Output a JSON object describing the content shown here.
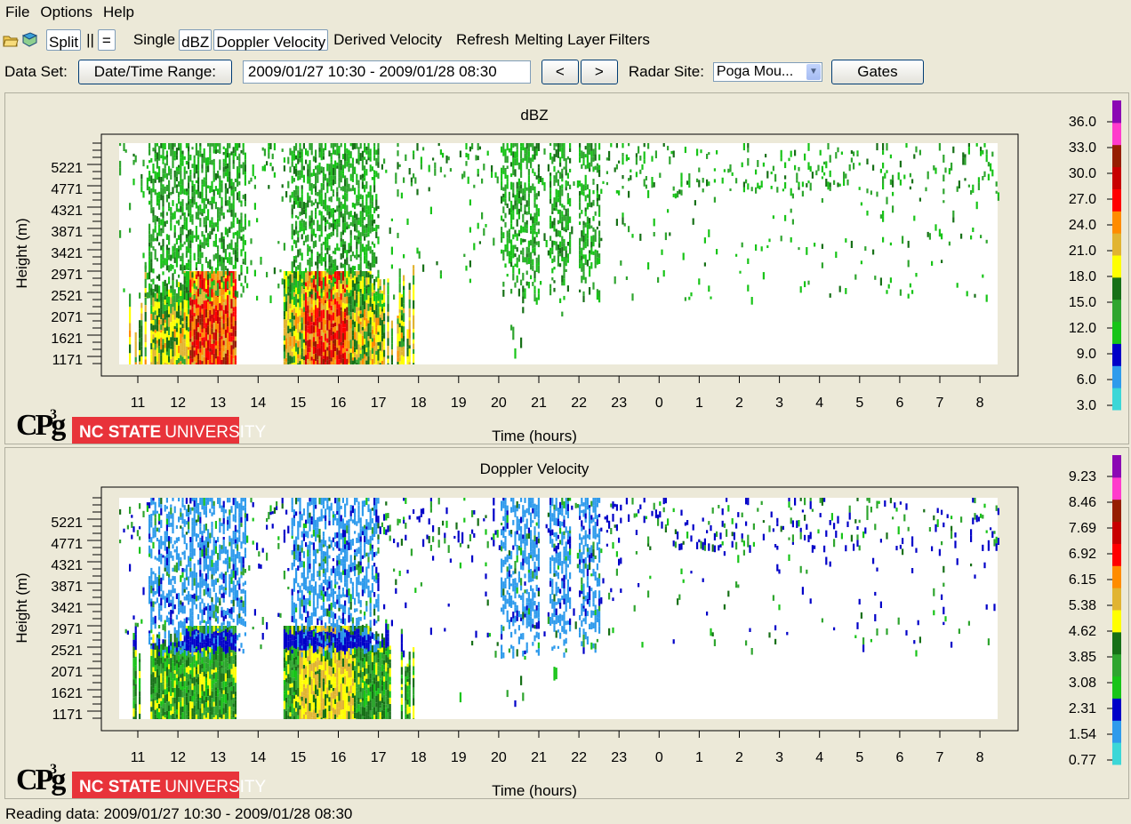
{
  "menu": [
    "File",
    "Options",
    "Help"
  ],
  "toolbar": {
    "split": "Split",
    "pause": "||",
    "equal": "=",
    "single": "Single",
    "dbz": "dBZ",
    "doppler": "Doppler Velocity",
    "derived": "Derived Velocity",
    "refresh": "Refresh",
    "melting": "Melting Layer",
    "filters": "Filters"
  },
  "dataset": {
    "label": "Data Set:",
    "range_button": "Date/Time Range:",
    "range_value": "2009/01/27 10:30 - 2009/01/28 08:30",
    "prev": "<",
    "next": ">",
    "site_label": "Radar Site:",
    "site_value": "Poga Mou...",
    "gates": "Gates"
  },
  "logos": {
    "cpg": "CPg",
    "cpg_sup": "3",
    "ncsu_bold": "NC STATE",
    "ncsu_light": "UNIVERSITY"
  },
  "colors": {
    "dbz": [
      "#3cd7d7",
      "#2f9bec",
      "#0000c8",
      "#18c418",
      "#2fa52f",
      "#177017",
      "#ffff00",
      "#e1b432",
      "#ff8c00",
      "#ff0000",
      "#c80000",
      "#961e00",
      "#ff3ccc",
      "#8b08b4"
    ],
    "vel": [
      "#3cd7d7",
      "#2f9bec",
      "#0000c8",
      "#18c418",
      "#2fa52f",
      "#177017",
      "#ffff00",
      "#e1b432",
      "#ff8c00",
      "#ff0000",
      "#c80000",
      "#961e00",
      "#ff3ccc",
      "#8b08b4"
    ]
  },
  "chart_data": [
    {
      "type": "heatmap",
      "title": "dBZ",
      "xlabel": "Time (hours)",
      "ylabel": "Height (m)",
      "x_ticks": [
        "11",
        "12",
        "13",
        "14",
        "15",
        "16",
        "17",
        "18",
        "19",
        "20",
        "21",
        "22",
        "23",
        "0",
        "1",
        "2",
        "3",
        "4",
        "5",
        "6",
        "7",
        "8"
      ],
      "y_ticks": [
        "5221",
        "4771",
        "4321",
        "3871",
        "3421",
        "2971",
        "2521",
        "2071",
        "1621",
        "1171"
      ],
      "colorbar": [
        "36.0",
        "33.0",
        "30.0",
        "27.0",
        "24.0",
        "21.0",
        "18.0",
        "15.0",
        "12.0",
        "9.0",
        "6.0",
        "3.0"
      ]
    },
    {
      "type": "heatmap",
      "title": "Doppler Velocity",
      "xlabel": "Time (hours)",
      "ylabel": "Height (m)",
      "x_ticks": [
        "11",
        "12",
        "13",
        "14",
        "15",
        "16",
        "17",
        "18",
        "19",
        "20",
        "21",
        "22",
        "23",
        "0",
        "1",
        "2",
        "3",
        "4",
        "5",
        "6",
        "7",
        "8"
      ],
      "y_ticks": [
        "5221",
        "4771",
        "4321",
        "3871",
        "3421",
        "2971",
        "2521",
        "2071",
        "1621",
        "1171"
      ],
      "colorbar": [
        "9.23",
        "8.46",
        "7.69",
        "6.92",
        "6.15",
        "5.38",
        "4.62",
        "3.85",
        "3.08",
        "2.31",
        "1.54",
        "0.77"
      ]
    }
  ],
  "status": "Reading data: 2009/01/27 10:30 - 2009/01/28 08:30"
}
